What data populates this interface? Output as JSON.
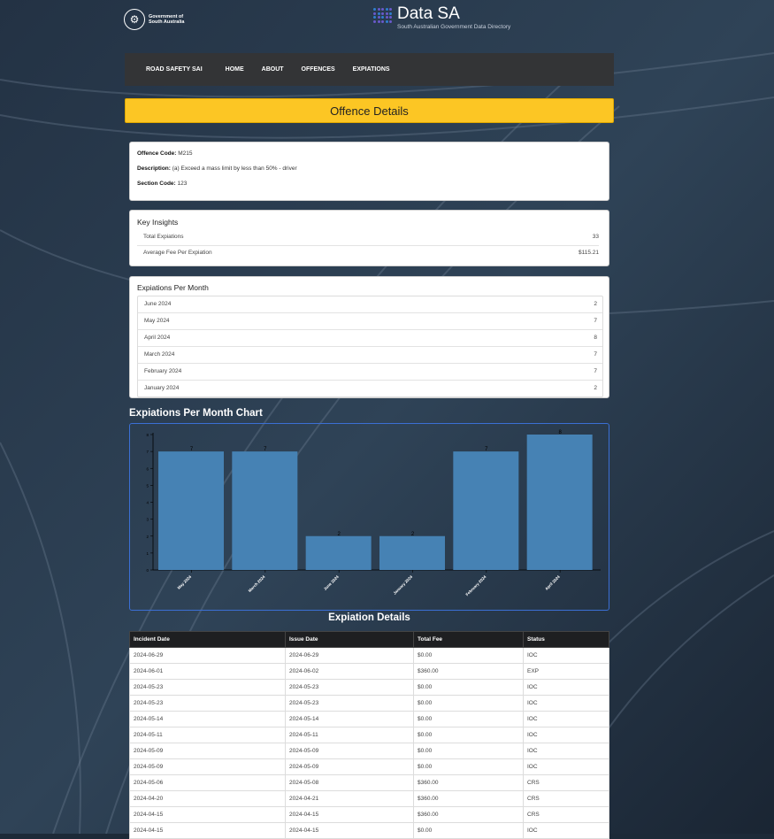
{
  "header": {
    "gov_logo_text": [
      "Government of",
      "South Australia"
    ],
    "datasa_title": "Data SA",
    "datasa_subtitle": "South Australian Government Data Directory"
  },
  "nav": {
    "brand": "ROAD SAFETY SAI",
    "links": [
      "HOME",
      "ABOUT",
      "OFFENCES",
      "EXPIATIONS"
    ]
  },
  "banner": {
    "title": "Offence Details"
  },
  "offence": {
    "code_label": "Offence Code:",
    "code": "M215",
    "desc_label": "Description:",
    "desc": "(a) Exceed a mass limit by less than 50% - driver",
    "section_label": "Section Code:",
    "section": "123"
  },
  "insights": {
    "title": "Key Insights",
    "rows": [
      {
        "label": "Total Expiations",
        "value": "33"
      },
      {
        "label": "Average Fee Per Expiation",
        "value": "$115.21"
      }
    ]
  },
  "per_month": {
    "title": "Expiations Per Month",
    "rows": [
      {
        "label": "June 2024",
        "value": "2"
      },
      {
        "label": "May 2024",
        "value": "7"
      },
      {
        "label": "April 2024",
        "value": "8"
      },
      {
        "label": "March 2024",
        "value": "7"
      },
      {
        "label": "February 2024",
        "value": "7"
      },
      {
        "label": "January 2024",
        "value": "2"
      }
    ]
  },
  "chart_section": {
    "title": "Expiations Per Month Chart"
  },
  "chart_data": {
    "type": "bar",
    "categories": [
      "May 2024",
      "March 2024",
      "June 2024",
      "January 2024",
      "February 2024",
      "April 2024"
    ],
    "values": [
      7,
      7,
      2,
      2,
      7,
      8
    ],
    "ylim": [
      0,
      8
    ],
    "yticks": [
      0,
      1,
      2,
      3,
      4,
      5,
      6,
      7,
      8
    ],
    "color": "#4682b4"
  },
  "details": {
    "title": "Expiation Details",
    "columns": [
      "Incident Date",
      "Issue Date",
      "Total Fee",
      "Status"
    ],
    "rows": [
      [
        "2024-06-29",
        "2024-06-29",
        "$0.00",
        "IOC"
      ],
      [
        "2024-06-01",
        "2024-06-02",
        "$360.00",
        "EXP"
      ],
      [
        "2024-05-23",
        "2024-05-23",
        "$0.00",
        "IOC"
      ],
      [
        "2024-05-23",
        "2024-05-23",
        "$0.00",
        "IOC"
      ],
      [
        "2024-05-14",
        "2024-05-14",
        "$0.00",
        "IOC"
      ],
      [
        "2024-05-11",
        "2024-05-11",
        "$0.00",
        "IOC"
      ],
      [
        "2024-05-09",
        "2024-05-09",
        "$0.00",
        "IOC"
      ],
      [
        "2024-05-09",
        "2024-05-09",
        "$0.00",
        "IOC"
      ],
      [
        "2024-05-06",
        "2024-05-08",
        "$360.00",
        "CRS"
      ],
      [
        "2024-04-20",
        "2024-04-21",
        "$360.00",
        "CRS"
      ],
      [
        "2024-04-15",
        "2024-04-15",
        "$360.00",
        "CRS"
      ],
      [
        "2024-04-15",
        "2024-04-15",
        "$0.00",
        "IOC"
      ]
    ]
  }
}
